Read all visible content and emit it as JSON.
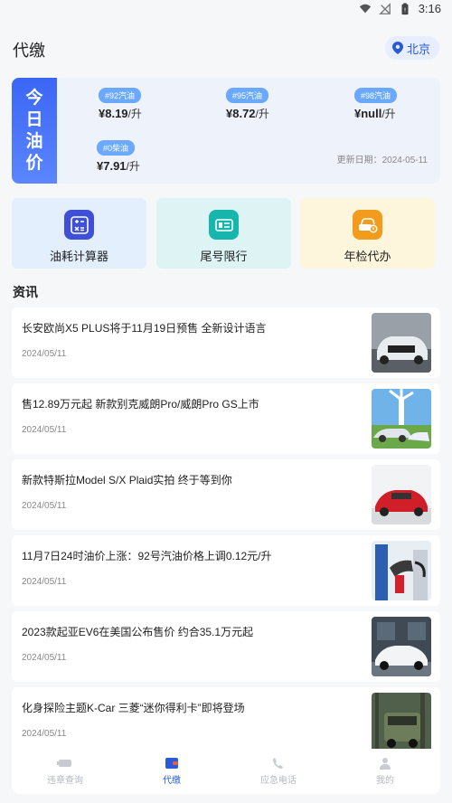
{
  "status_bar": {
    "time": "3:16"
  },
  "header": {
    "title": "代缴",
    "location": "北京"
  },
  "oil_card": {
    "side_chars": [
      "今",
      "日",
      "油",
      "价"
    ],
    "prices": [
      {
        "tag": "#92汽油",
        "value": "¥8.19",
        "unit": "/升"
      },
      {
        "tag": "#95汽油",
        "value": "¥8.72",
        "unit": "/升"
      },
      {
        "tag": "#98汽油",
        "value": "¥null",
        "unit": "/升"
      },
      {
        "tag": "#0柴油",
        "value": "¥7.91",
        "unit": "/升"
      }
    ],
    "update_date": "更新日期：2024-05-11"
  },
  "tools": [
    {
      "label": "油耗计算器",
      "icon": "calculator-icon",
      "bg": "#e3effd",
      "icon_bg": "#3e4fd8"
    },
    {
      "label": "尾号限行",
      "icon": "license-plate-icon",
      "bg": "#def4f4",
      "icon_bg": "#16b6ad"
    },
    {
      "label": "年检代办",
      "icon": "car-inspection-icon",
      "bg": "#fdf5dc",
      "icon_bg": "#f29b1c"
    }
  ],
  "news_section_title": "资讯",
  "news": [
    {
      "title": "长安欧尚X5 PLUS将于11月19日预售 全新设计语言",
      "date": "2024/05/11"
    },
    {
      "title": "售12.89万元起 新款别克威朗Pro/威朗Pro GS上市",
      "date": "2024/05/11"
    },
    {
      "title": "新款特斯拉Model S/X Plaid实拍 终于等到你",
      "date": "2024/05/11"
    },
    {
      "title": "11月7日24时油价上涨：92号汽油价格上调0.12元/升",
      "date": "2024/05/11"
    },
    {
      "title": "2023款起亚EV6在美国公布售价 约合35.1万元起",
      "date": "2024/05/11"
    },
    {
      "title": "化身探险主题K-Car 三菱“迷你得利卡”即将登场",
      "date": "2024/05/11"
    }
  ],
  "tabbar": [
    {
      "label": "违章查询",
      "icon": "camera-icon",
      "active": false
    },
    {
      "label": "代缴",
      "icon": "wallet-icon",
      "active": true
    },
    {
      "label": "应急电话",
      "icon": "phone-icon",
      "active": false
    },
    {
      "label": "我的",
      "icon": "user-icon",
      "active": false
    }
  ]
}
